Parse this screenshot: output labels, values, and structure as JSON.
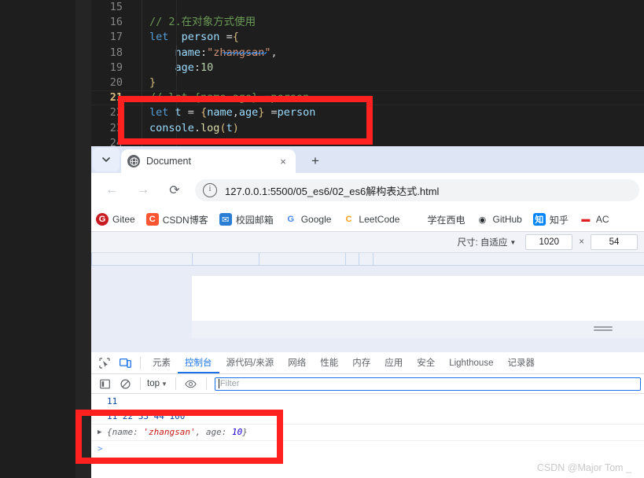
{
  "editor": {
    "lines": [
      {
        "num": "15",
        "active": false,
        "tokens": []
      },
      {
        "num": "16",
        "active": false,
        "tokens": [
          {
            "t": "com",
            "s": "// 2.在对象方式使用"
          }
        ]
      },
      {
        "num": "17",
        "active": false,
        "tokens": [
          {
            "t": "kw",
            "s": "let"
          },
          {
            "t": "plain",
            "s": "  "
          },
          {
            "t": "var",
            "s": "person"
          },
          {
            "t": "plain",
            "s": " ="
          },
          {
            "t": "brace",
            "s": "{"
          }
        ]
      },
      {
        "num": "18",
        "active": false,
        "tokens": [
          {
            "t": "plain",
            "s": "    "
          },
          {
            "t": "var",
            "s": "name"
          },
          {
            "t": "plain",
            "s": ":"
          },
          {
            "t": "str",
            "s": "\"zhangsan\""
          },
          {
            "t": "plain",
            "s": ","
          }
        ]
      },
      {
        "num": "19",
        "active": false,
        "tokens": [
          {
            "t": "plain",
            "s": "    "
          },
          {
            "t": "var",
            "s": "age"
          },
          {
            "t": "plain",
            "s": ":"
          },
          {
            "t": "num",
            "s": "10"
          }
        ]
      },
      {
        "num": "20",
        "active": false,
        "tokens": [
          {
            "t": "brace",
            "s": "}"
          }
        ]
      },
      {
        "num": "21",
        "active": true,
        "tokens": [
          {
            "t": "com",
            "s": "// let {name,age} =person"
          }
        ]
      },
      {
        "num": "22",
        "active": false,
        "tokens": [
          {
            "t": "kw",
            "s": "let"
          },
          {
            "t": "plain",
            "s": " "
          },
          {
            "t": "var",
            "s": "t"
          },
          {
            "t": "plain",
            "s": " = "
          },
          {
            "t": "brace",
            "s": "{"
          },
          {
            "t": "var",
            "s": "name"
          },
          {
            "t": "plain",
            "s": ","
          },
          {
            "t": "var",
            "s": "age"
          },
          {
            "t": "brace",
            "s": "}"
          },
          {
            "t": "plain",
            "s": " ="
          },
          {
            "t": "var",
            "s": "person"
          }
        ]
      },
      {
        "num": "23",
        "active": false,
        "tokens": [
          {
            "t": "var",
            "s": "console"
          },
          {
            "t": "plain",
            "s": "."
          },
          {
            "t": "fn",
            "s": "log"
          },
          {
            "t": "paren",
            "s": "("
          },
          {
            "t": "var",
            "s": "t"
          },
          {
            "t": "paren",
            "s": ")"
          }
        ]
      },
      {
        "num": "24",
        "active": false,
        "tokens": []
      }
    ]
  },
  "browser": {
    "tab_list_icon": "chevron-down-icon",
    "tab": {
      "title": "Document",
      "favicon": "globe-icon",
      "close": "×"
    },
    "new_tab": "+",
    "nav": {
      "back": "←",
      "forward": "→",
      "reload": "⟳"
    },
    "omnibox": {
      "info_icon": "i",
      "url": "127.0.0.1:5500/05_es6/02_es6解构表达式.html"
    },
    "bookmarks": [
      {
        "label": "Gitee",
        "glyph": "G",
        "bg": "#c71d23",
        "fg": "#ffffff",
        "icon": "gitee-icon"
      },
      {
        "label": "CSDN博客",
        "glyph": "C",
        "bg": "#fc5531",
        "fg": "#ffffff",
        "icon": "csdn-icon"
      },
      {
        "label": "校园邮箱",
        "glyph": "✉",
        "bg": "#2a7fd4",
        "fg": "#ffffff",
        "icon": "mail-icon"
      },
      {
        "label": "Google",
        "glyph": "G",
        "bg": "#ffffff",
        "fg": "#4285f4",
        "icon": "google-icon"
      },
      {
        "label": "LeetCode",
        "glyph": "C",
        "bg": "#ffffff",
        "fg": "#ffa116",
        "icon": "leetcode-icon"
      },
      {
        "label": "学在西电",
        "glyph": "",
        "bg": "#ffffff",
        "fg": "#3c4043",
        "icon": "xidian-icon"
      },
      {
        "label": "GitHub",
        "glyph": "◉",
        "bg": "#ffffff",
        "fg": "#24292e",
        "icon": "github-icon"
      },
      {
        "label": "知乎",
        "glyph": "知",
        "bg": "#0084ff",
        "fg": "#ffffff",
        "icon": "zhihu-icon"
      },
      {
        "label": "AC",
        "glyph": "▬",
        "bg": "#ffffff",
        "fg": "#e02020",
        "icon": "acwing-icon"
      }
    ]
  },
  "device_toolbar": {
    "size_label": "尺寸: 自适应",
    "caret": "▼",
    "width": "1020",
    "separator": "×",
    "height": "54"
  },
  "devtools": {
    "icons": [
      {
        "name": "inspect-element-icon",
        "glyph": "⌶"
      },
      {
        "name": "device-toolbar-icon",
        "glyph": "▭"
      }
    ],
    "tabs": [
      {
        "label": "元素",
        "active": false
      },
      {
        "label": "控制台",
        "active": true
      },
      {
        "label": "源代码/来源",
        "active": false
      },
      {
        "label": "网络",
        "active": false
      },
      {
        "label": "性能",
        "active": false
      },
      {
        "label": "内存",
        "active": false
      },
      {
        "label": "应用",
        "active": false
      },
      {
        "label": "安全",
        "active": false
      },
      {
        "label": "Lighthouse",
        "active": false
      },
      {
        "label": "记录器",
        "active": false
      }
    ],
    "console_toolbar": {
      "sidebar_icon": "console-sidebar-icon",
      "clear_icon": "clear-console-icon",
      "context": "top",
      "context_caret": "▼",
      "eye_icon": "live-expression-icon",
      "filter_placeholder": "Filter",
      "filter_value": ""
    },
    "console_output": {
      "row1": "11",
      "row2": "11 22 33 44 100",
      "object": {
        "arrow": "▶",
        "open": "{name: ",
        "string": "'zhangsan'",
        "mid": ", age: ",
        "number": "10",
        "close": "}"
      },
      "prompt": ">"
    }
  },
  "watermark": "CSDN @Major Tom _",
  "colors": {
    "accent_blue": "#1a73e8",
    "annotation_red": "#ff2020",
    "editor_bg": "#1e1e1e"
  }
}
